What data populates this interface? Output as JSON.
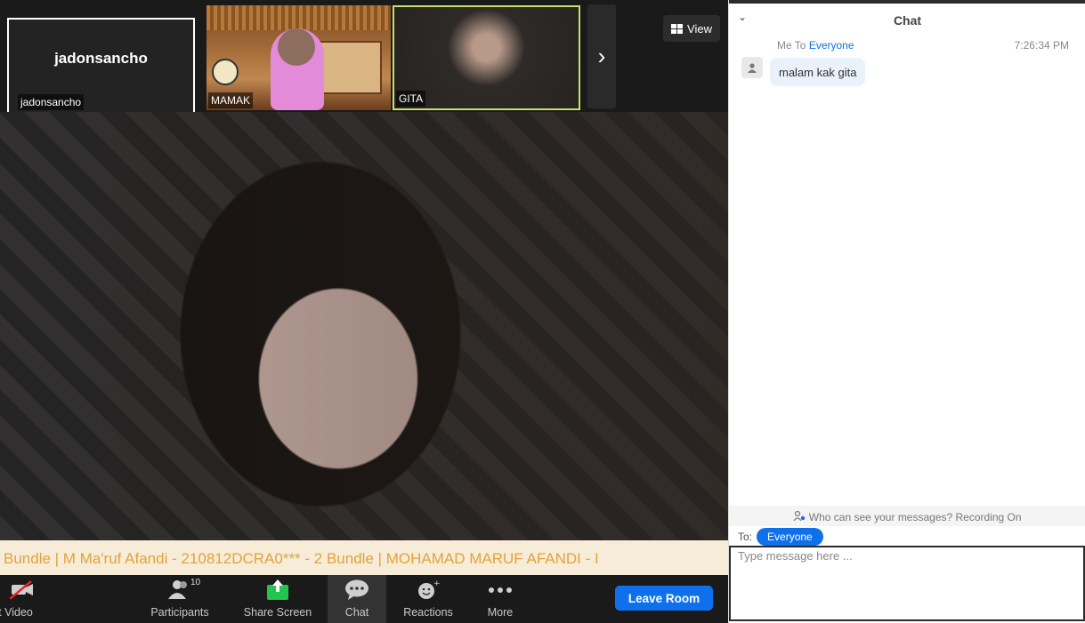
{
  "thumbnails": {
    "self": {
      "display_name": "jadonsancho",
      "label": "jadonsancho"
    },
    "mamak": {
      "label": "MAMAK"
    },
    "gita": {
      "label": "GITA"
    }
  },
  "view_button": {
    "label": "View",
    "icon": "grid-icon"
  },
  "ticker_text": "Bundle   |   M Ma'ruf Afandi - 210812DCRA0*** - 2 Bundle   |   MOHAMAD MARUF AFANDI - I",
  "toolbar": {
    "video_label": "rt Video",
    "participants_label": "Participants",
    "participants_count": "10",
    "share_label": "Share Screen",
    "chat_label": "Chat",
    "reactions_label": "Reactions",
    "more_label": "More",
    "leave_label": "Leave Room"
  },
  "chat": {
    "title": "Chat",
    "message": {
      "from": "Me",
      "to_word": "To",
      "to_target": "Everyone",
      "time": "7:26:34 PM",
      "text": "malam kak gita"
    },
    "who_can_see": "Who can see your messages? Recording On",
    "to_label": "To:",
    "to_value": "Everyone",
    "input_placeholder": "Type message here ..."
  },
  "colors": {
    "accent": "#0e71eb",
    "toolbar_bg": "#1a1a1a",
    "share_green": "#23c552"
  }
}
